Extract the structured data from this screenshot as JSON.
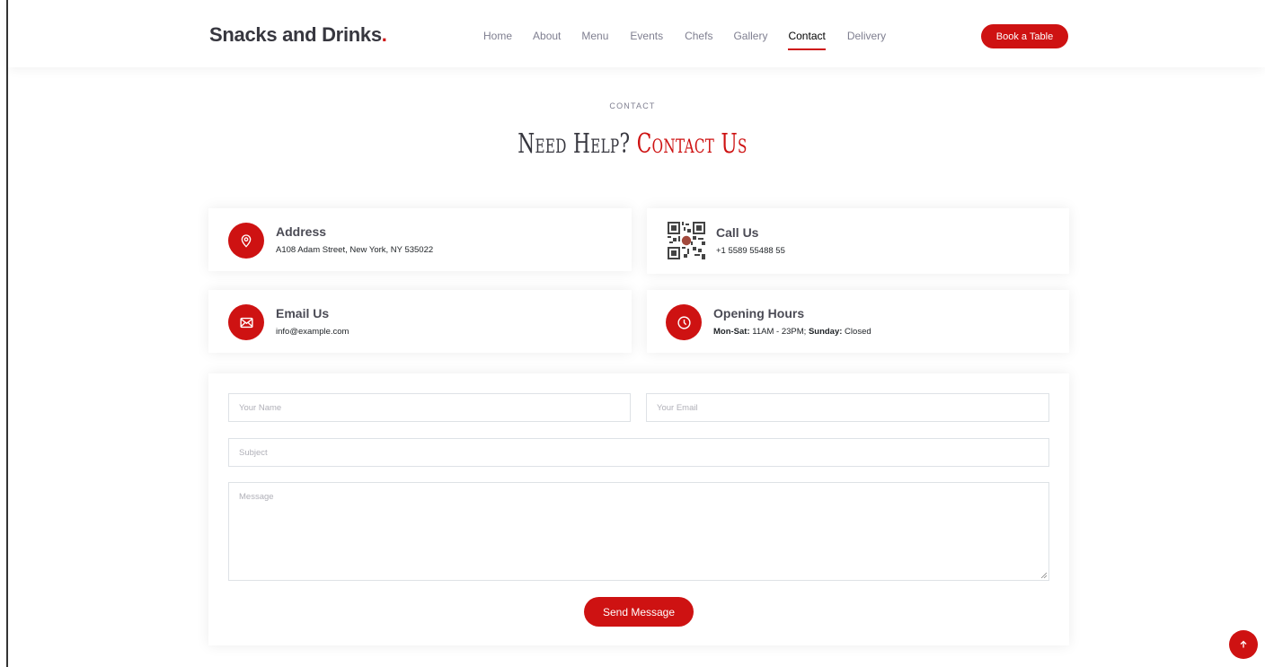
{
  "header": {
    "logo_text": "Snacks and Drinks",
    "logo_dot": ".",
    "nav": [
      {
        "label": "Home"
      },
      {
        "label": "About"
      },
      {
        "label": "Menu"
      },
      {
        "label": "Events"
      },
      {
        "label": "Chefs"
      },
      {
        "label": "Gallery"
      },
      {
        "label": "Contact"
      },
      {
        "label": "Delivery"
      }
    ],
    "active_nav": "Contact",
    "book_label": "Book a Table"
  },
  "section": {
    "eyebrow": "CONTACT",
    "title_plain": "Need Help? ",
    "title_accent": "Contact Us"
  },
  "info": {
    "address": {
      "title": "Address",
      "text": "A108 Adam Street, New York, NY 535022",
      "icon": "map-pin-icon"
    },
    "call": {
      "title": "Call Us",
      "text": "+1 5589 55488 55",
      "icon": "qr-code-icon"
    },
    "email": {
      "title": "Email Us",
      "text": "info@example.com",
      "icon": "envelope-icon"
    },
    "hours": {
      "title": "Opening Hours",
      "days1": "Mon-Sat:",
      "time1": " 11AM - 23PM; ",
      "days2": "Sunday:",
      "time2": " Closed",
      "icon": "clock-icon"
    }
  },
  "form": {
    "name_placeholder": "Your Name",
    "email_placeholder": "Your Email",
    "subject_placeholder": "Subject",
    "message_placeholder": "Message",
    "submit_label": "Send Message"
  },
  "colors": {
    "accent": "#ce1212",
    "heading": "#37373f",
    "muted": "#7f7f90"
  }
}
